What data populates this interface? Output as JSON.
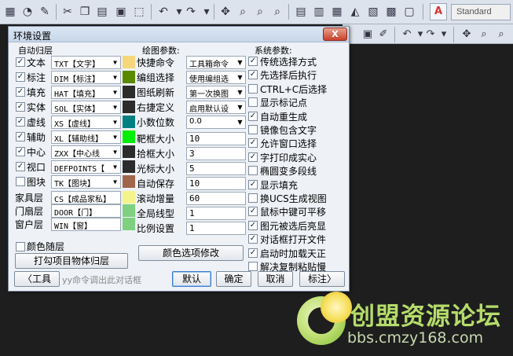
{
  "toolbar": {
    "style_label": "Standard",
    "text_style_icon": "A"
  },
  "dialog": {
    "title": "环境设置",
    "close_label": "X"
  },
  "auto_layer": {
    "title": "自动归层",
    "rows": [
      {
        "label": "文本",
        "checked": true,
        "value": "TXT【文字】",
        "color": "#f6d67a"
      },
      {
        "label": "标注",
        "checked": true,
        "value": "DIM【标注】",
        "color": "#5b8a00"
      },
      {
        "label": "填充",
        "checked": true,
        "value": "HAT【填充】",
        "color": "#2c2c2c"
      },
      {
        "label": "实体",
        "checked": true,
        "value": "SOL【实体】",
        "color": "#2c2c2c"
      },
      {
        "label": "虚线",
        "checked": true,
        "value": "XS【虚线】",
        "color": "#008080"
      },
      {
        "label": "辅助",
        "checked": true,
        "value": "XL【辅助线】",
        "color": "#00ee00"
      },
      {
        "label": "中心",
        "checked": true,
        "value": "ZXX【中心线",
        "color": "#2c2c2c"
      },
      {
        "label": "视口",
        "checked": true,
        "value": "DEFPOINTS【",
        "color": "#2c2c2c"
      },
      {
        "label": "图块",
        "checked": false,
        "value": "TK【图块】",
        "color": "#a0664a"
      }
    ],
    "text_rows": [
      {
        "label": "家具层",
        "value": "CS【成品家私】",
        "color": "#f4f48a"
      },
      {
        "label": "门扇层",
        "value": "DOOR【门】",
        "color": "#7fd07f"
      },
      {
        "label": "窗户层",
        "value": "WIN【窗】",
        "color": "#7fd07f"
      }
    ],
    "color_follow_label": "颜色随层",
    "color_follow_checked": false,
    "apply_button": "打勾项目物体归层"
  },
  "drawing_params": {
    "title": "绘图参数:",
    "dropdown_rows": [
      {
        "label": "快捷命令",
        "value": "工具箱命令"
      },
      {
        "label": "编组选择",
        "value": "使用编组选"
      },
      {
        "label": "图纸刷新",
        "value": "第一次换图"
      },
      {
        "label": "右捷定义",
        "value": "启用默认设"
      },
      {
        "label": "小数位数",
        "value": "0.0"
      }
    ],
    "input_rows": [
      {
        "label": "靶框大小",
        "value": "10"
      },
      {
        "label": "拾框大小",
        "value": "3"
      },
      {
        "label": "光标大小",
        "value": "5"
      },
      {
        "label": "自动保存",
        "value": "10"
      },
      {
        "label": "滚动增量",
        "value": "60"
      },
      {
        "label": "全局线型",
        "value": "1"
      },
      {
        "label": "比例设置",
        "value": "1"
      }
    ],
    "color_button": "颜色选项修改"
  },
  "system_params": {
    "title": "系统参数:",
    "items": [
      {
        "label": "传统选择方式",
        "checked": true
      },
      {
        "label": "先选择后执行",
        "checked": true
      },
      {
        "label": "CTRL+C后选择",
        "checked": false
      },
      {
        "label": "显示标记点",
        "checked": false
      },
      {
        "label": "自动重生成",
        "checked": true
      },
      {
        "label": "镜像包含文字",
        "checked": false
      },
      {
        "label": "允许窗口选择",
        "checked": true
      },
      {
        "label": "字打印成实心",
        "checked": true
      },
      {
        "label": "椭圆变多段线",
        "checked": false
      },
      {
        "label": "显示填充",
        "checked": true
      },
      {
        "label": "换UCS生成视图",
        "checked": false
      },
      {
        "label": "鼠标中键可平移",
        "checked": true
      },
      {
        "label": "图元被选后亮显",
        "checked": true
      },
      {
        "label": "对话框打开文件",
        "checked": true
      },
      {
        "label": "启动时加载天正",
        "checked": true
      },
      {
        "label": "解决复制粘贴慢",
        "checked": false
      }
    ]
  },
  "footer": {
    "prev_button": "〈工具",
    "hint": "yy命令调出此对话框",
    "default_button": "默认",
    "ok_button": "确定",
    "cancel_button": "取消",
    "next_button": "标注〉"
  },
  "watermark": {
    "title": "创盟资源论坛",
    "url": "bbs.cmzy168.com"
  }
}
